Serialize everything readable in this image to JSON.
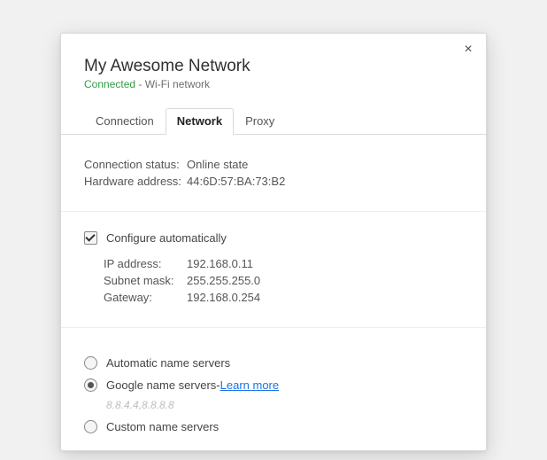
{
  "header": {
    "title": "My Awesome Network",
    "status_word": "Connected",
    "status_separator": " - ",
    "status_rest": "Wi-Fi network"
  },
  "close_glyph": "×",
  "tabs": [
    {
      "label": "Connection"
    },
    {
      "label": "Network"
    },
    {
      "label": "Proxy"
    }
  ],
  "status_section": {
    "rows": [
      {
        "k": "Connection status:",
        "v": "Online state"
      },
      {
        "k": "Hardware address:",
        "v": "44:6D:57:BA:73:B2"
      }
    ]
  },
  "config_section": {
    "checkbox_label": "Configure automatically",
    "rows": [
      {
        "k": "IP address:",
        "v": "192.168.0.11"
      },
      {
        "k": "Subnet mask:",
        "v": "255.255.255.0"
      },
      {
        "k": "Gateway:",
        "v": "192.168.0.254"
      }
    ]
  },
  "ns_section": {
    "auto_label": "Automatic name servers",
    "google_label": "Google name servers",
    "google_sep": " - ",
    "learn_more": "Learn more",
    "google_values": "8.8.4.4,8.8.8.8",
    "custom_label": "Custom name servers"
  }
}
